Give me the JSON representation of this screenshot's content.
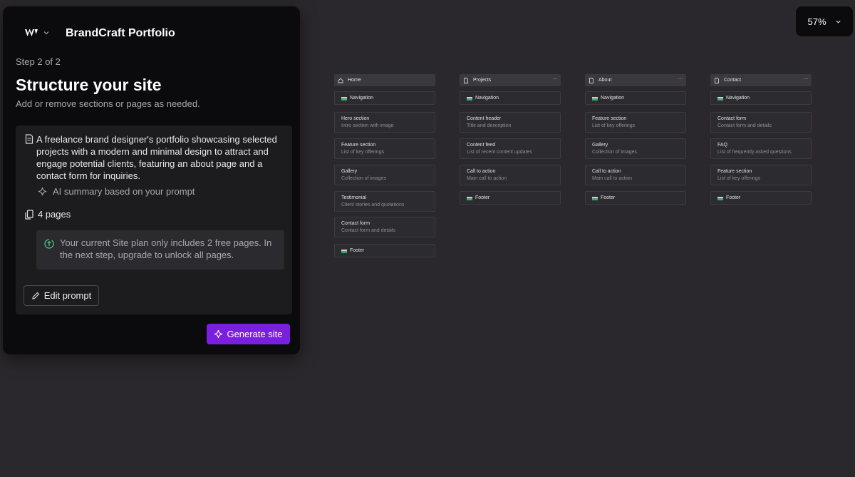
{
  "panel": {
    "project_name": "BrandCraft Portfolio",
    "step": "Step 2 of 2",
    "title": "Structure your site",
    "subtitle": "Add or remove sections or pages as needed.",
    "summary": "A freelance brand designer's portfolio showcasing selected projects with a modern and minimal design to attract and engage potential clients, featuring an about page and a contact form for inquiries.",
    "ai_label": "AI summary based on your prompt",
    "pages_label": "4 pages",
    "notice": "Your current Site plan only includes 2 free pages. In the next step, upgrade to unlock all pages.",
    "edit_button": "Edit prompt",
    "generate_button": "Generate site",
    "accent_color": "#7a1fe0"
  },
  "zoom": {
    "value": "57%"
  },
  "sitemap": {
    "home": {
      "name": "Home",
      "navigation": "Navigation",
      "footer": "Footer",
      "sections": [
        {
          "title": "Hero section",
          "desc": "Intro section with image"
        },
        {
          "title": "Feature section",
          "desc": "List of key offerings"
        },
        {
          "title": "Gallery",
          "desc": "Collection of images"
        },
        {
          "title": "Testimonial",
          "desc": "Client stories and quotations"
        },
        {
          "title": "Contact form",
          "desc": "Contact form and details"
        }
      ]
    },
    "projects": {
      "name": "Projects",
      "navigation": "Navigation",
      "footer": "Footer",
      "sections": [
        {
          "title": "Content header",
          "desc": "Title and description"
        },
        {
          "title": "Content feed",
          "desc": "List of recent content updates"
        },
        {
          "title": "Call to action",
          "desc": "Main call to action"
        }
      ]
    },
    "about": {
      "name": "About",
      "navigation": "Navigation",
      "footer": "Footer",
      "sections": [
        {
          "title": "Feature section",
          "desc": "List of key offerings"
        },
        {
          "title": "Gallery",
          "desc": "Collection of images"
        },
        {
          "title": "Call to action",
          "desc": "Main call to action"
        }
      ]
    },
    "contact": {
      "name": "Contact",
      "navigation": "Navigation",
      "footer": "Footer",
      "sections": [
        {
          "title": "Contact form",
          "desc": "Contact form and details"
        },
        {
          "title": "FAQ",
          "desc": "List of frequently asked questions"
        },
        {
          "title": "Feature section",
          "desc": "List of key offerings"
        }
      ]
    }
  }
}
